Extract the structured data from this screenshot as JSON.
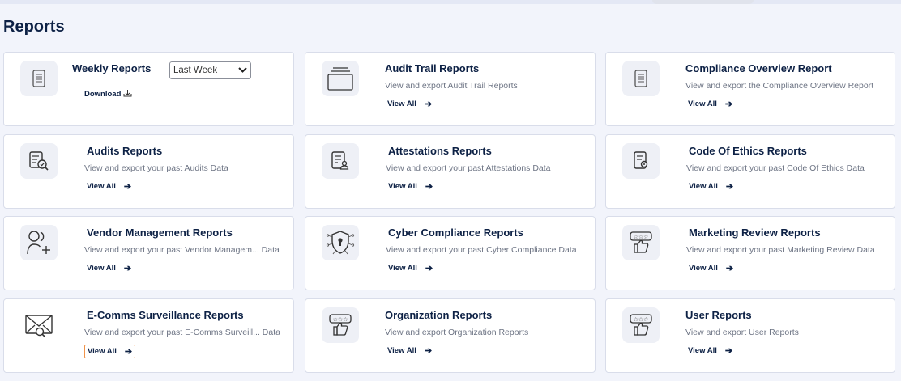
{
  "page": {
    "title": "Reports"
  },
  "weekly": {
    "title": "Weekly Reports",
    "period_selected": "Last Week",
    "download_label": "Download",
    "download_icon": "download-icon"
  },
  "cards": [
    {
      "title": "Audit Trail Reports",
      "description": "View and export Audit Trail Reports",
      "view_all": "View All",
      "icon": "folder-icon"
    },
    {
      "title": "Compliance Overview Report",
      "description": "View and export the Compliance Overview Report",
      "view_all": "View All",
      "icon": "document-icon"
    },
    {
      "title": "Audits Reports",
      "description": "View and export your past Audits Data",
      "view_all": "View All",
      "icon": "audit-checklist-icon"
    },
    {
      "title": "Attestations Reports",
      "description": "View and export your past Attestations Data",
      "view_all": "View All",
      "icon": "attestation-document-icon"
    },
    {
      "title": "Code Of Ethics Reports",
      "description": "View and export your past Code Of Ethics Data",
      "view_all": "View All",
      "icon": "ethics-document-icon"
    },
    {
      "title": "Vendor Management Reports",
      "description": "View and export your past Vendor Managem...  Data",
      "view_all": "View All",
      "icon": "add-user-icon"
    },
    {
      "title": "Cyber Compliance Reports",
      "description": "View and export your past Cyber Compliance Data",
      "view_all": "View All",
      "icon": "shield-lock-icon"
    },
    {
      "title": "Marketing Review Reports",
      "description": "View and export your past Marketing Review Data",
      "view_all": "View All",
      "icon": "rating-thumbs-up-icon"
    },
    {
      "title": "E-Comms Surveillance Reports",
      "description": "View and export your past E-Comms Surveill...  Data",
      "view_all": "View All",
      "icon": "mail-search-icon"
    },
    {
      "title": "Organization Reports",
      "description": "View and export Organization Reports",
      "view_all": "View All",
      "icon": "rating-thumbs-up-icon"
    },
    {
      "title": "User Reports",
      "description": "View and export User Reports",
      "view_all": "View All",
      "icon": "rating-thumbs-up-icon"
    }
  ],
  "arrow_glyph": "➔",
  "colors": {
    "title": "#0d2145",
    "focus_outline": "#f0934a",
    "icon_bg": "#eef0f6"
  }
}
